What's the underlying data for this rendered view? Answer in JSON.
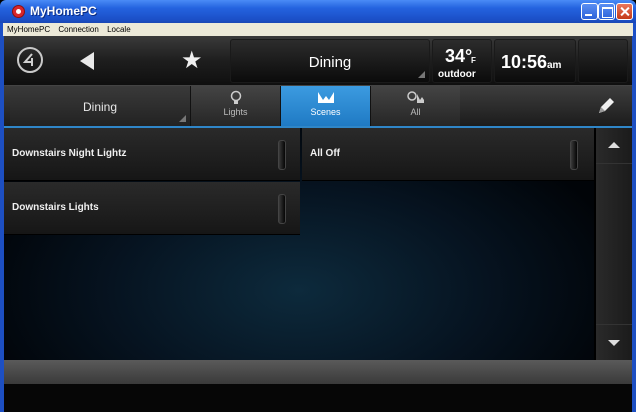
{
  "window": {
    "title": "MyHomePC"
  },
  "menu": {
    "items": [
      "MyHomePC",
      "Connection",
      "Locale"
    ]
  },
  "header": {
    "room": "Dining",
    "temperature": "34°",
    "temperature_unit": "F",
    "temperature_label": "outdoor",
    "time": "10:56",
    "time_ampm": "am"
  },
  "tabs": {
    "room_selector": "Dining",
    "items": [
      {
        "label": "Lights",
        "icon": "bulb-icon",
        "active": false
      },
      {
        "label": "Scenes",
        "icon": "scenes-icon",
        "active": true
      },
      {
        "label": "All",
        "icon": "all-icon",
        "active": false
      }
    ]
  },
  "scenes": [
    {
      "label": "Downstairs Night Lightz",
      "column": "left"
    },
    {
      "label": "All Off",
      "column": "right"
    },
    {
      "label": "Downstairs Lights",
      "column": "left"
    }
  ],
  "colors": {
    "accent": "#2f86c8",
    "titlebar": "#2463df"
  }
}
